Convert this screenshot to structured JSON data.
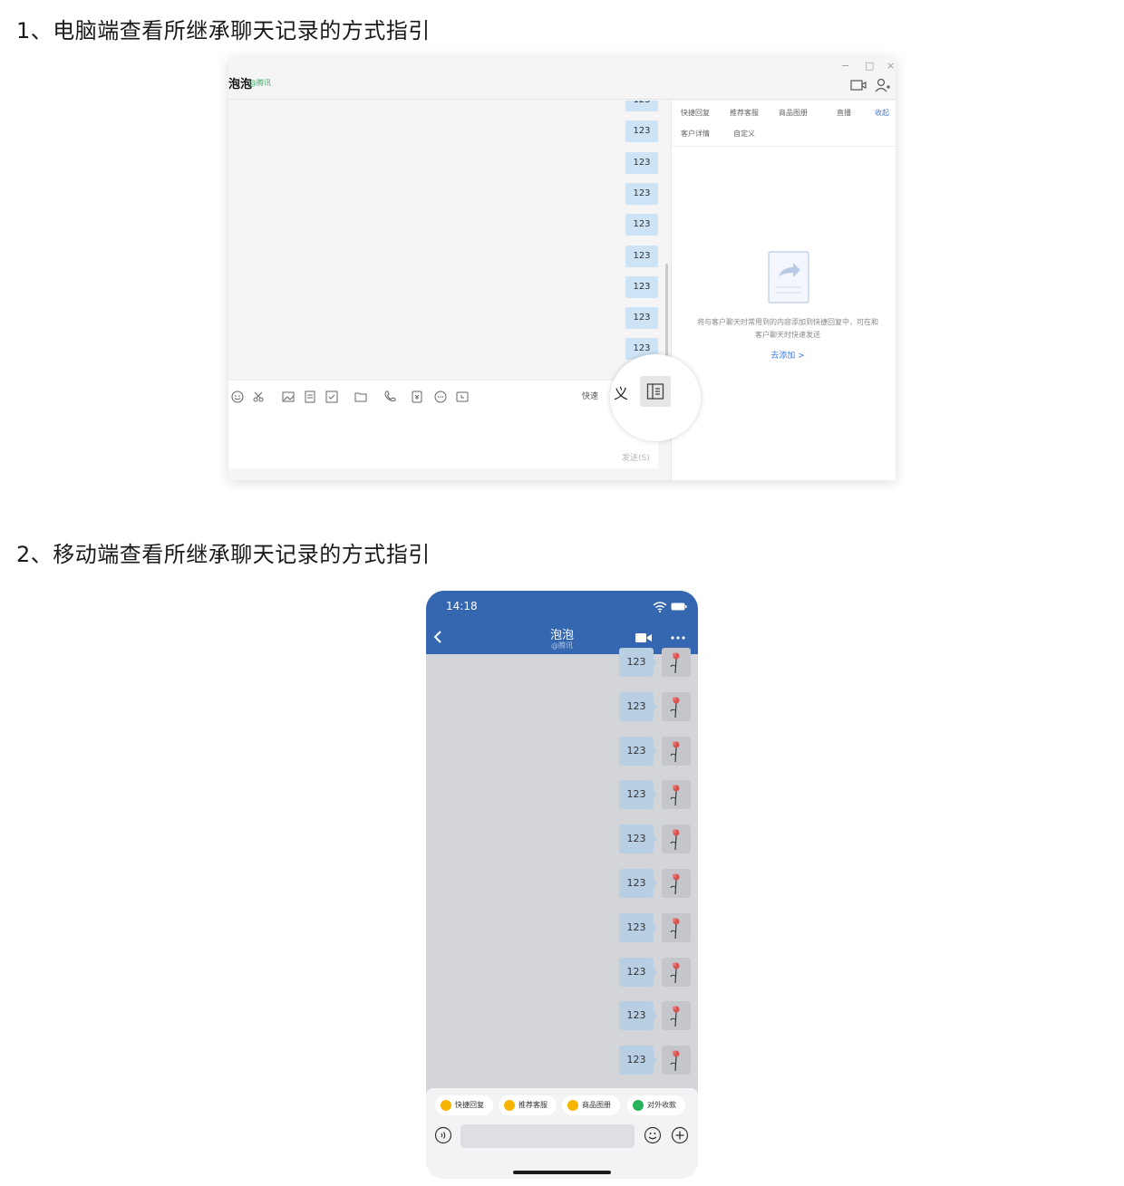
{
  "headings": {
    "desktop_guide": "1、电脑端查看所继承聊天记录的方式指引",
    "mobile_guide": "2、移动端查看所继承聊天记录的方式指引"
  },
  "desktop": {
    "contact_name": "泡泡",
    "contact_corp": "@腾讯",
    "window_controls": [
      "−",
      "□",
      "×"
    ],
    "message_text": "123",
    "message_count": 9,
    "toolbar_icons": [
      "emoji-icon",
      "scissors-icon",
      "image-icon",
      "file-icon",
      "checklist-icon",
      "folder-icon",
      "phone-icon",
      "red-packet-icon",
      "more-icon",
      "schedule-icon"
    ],
    "quick_reply_label": "快速",
    "send_button": "发送(S)",
    "side_tabs": [
      "快捷回复",
      "推荐客服",
      "商品图册",
      "直播",
      "收起"
    ],
    "side_tabs_row2": [
      "客户详情",
      "自定义"
    ],
    "empty_message": "将与客户聊天时常用到的内容添加到快捷回复中，可在和客户聊天时快速发送",
    "add_link": "去添加 >",
    "magnifier_text": "义",
    "accent_color": "#3b7de0"
  },
  "mobile": {
    "status_time": "14:18",
    "contact_name": "泡泡",
    "contact_corp": "@腾讯",
    "message_text": "123",
    "message_count": 10,
    "quick_actions": [
      {
        "label": "快捷回复",
        "color": "#f5b400"
      },
      {
        "label": "推荐客服",
        "color": "#f5b400"
      },
      {
        "label": "商品图册",
        "color": "#f5b400"
      },
      {
        "label": "对外收款",
        "color": "#27b35a"
      }
    ],
    "header_color": "#3467b0"
  }
}
